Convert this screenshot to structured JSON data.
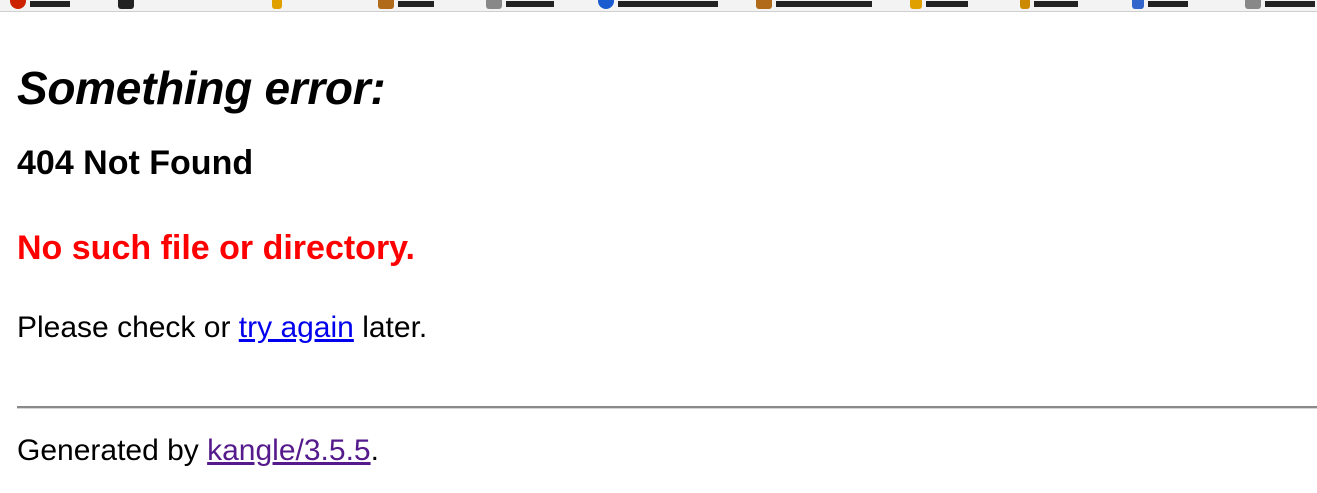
{
  "toolbar": {
    "items": [
      {
        "icon": "red-circle-icon",
        "color": "#cc2200"
      },
      {
        "icon": "window-icon",
        "color": "#222222"
      },
      {
        "icon": "pencil-icon",
        "color": "#e0a000"
      },
      {
        "icon": "document-icon",
        "color": "#b06a1a"
      },
      {
        "icon": "page-icon",
        "color": "#888888"
      },
      {
        "icon": "globe-icon",
        "color": "#1a5bd0"
      },
      {
        "icon": "notebook-icon",
        "color": "#b06a1a"
      },
      {
        "icon": "pencil-icon",
        "color": "#e0a000"
      },
      {
        "icon": "tag-icon",
        "color": "#cc8a00"
      },
      {
        "icon": "tools-icon",
        "color": "#3366cc"
      },
      {
        "icon": "page-icon",
        "color": "#888888"
      }
    ]
  },
  "page": {
    "title": "Something error:",
    "error_code": "404 Not Found",
    "error_message": "No such file or directory.",
    "hint_prefix": "Please check or ",
    "hint_link": "try again",
    "hint_suffix": " later.",
    "footer_prefix": "Generated by ",
    "footer_link": "kangle/3.5.5",
    "footer_suffix": "."
  },
  "colors": {
    "error_message": "#ff0000",
    "link": "#0000ee",
    "visited_link": "#551a8b"
  }
}
